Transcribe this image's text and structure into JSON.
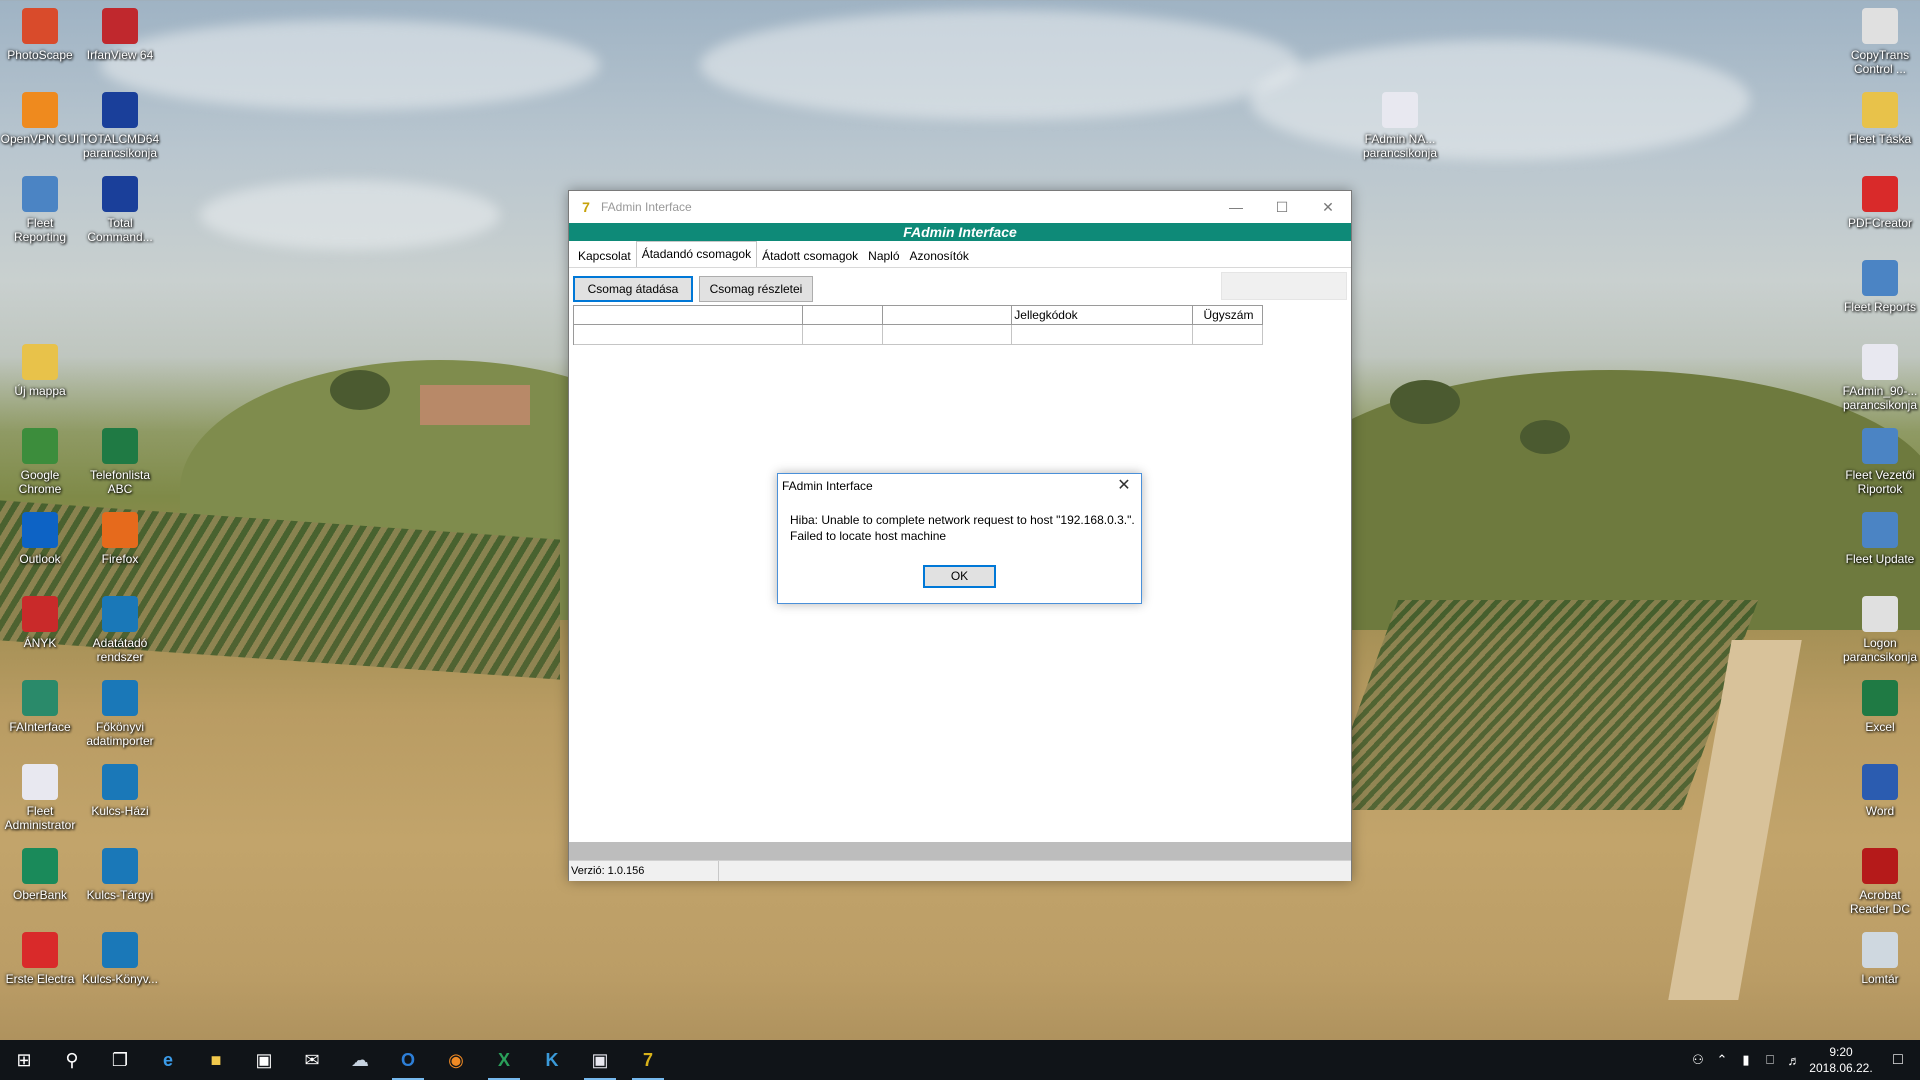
{
  "desktop": {
    "left_icons": [
      {
        "label": "PhotoScape",
        "icon": "photoscape-icon",
        "color": "#d94b2b"
      },
      {
        "label": "IrfanView 64",
        "icon": "irfanview-icon",
        "color": "#c0282d"
      },
      {
        "label": "OpenVPN GUI",
        "icon": "openvpn-icon",
        "color": "#ef8a1e"
      },
      {
        "label": "TOTALCMD64 parancsikonja",
        "icon": "totalcmd-icon",
        "color": "#1a3f9a"
      },
      {
        "label": "Fleet Reporting",
        "icon": "fleet-reporting-icon",
        "color": "#4b84c4"
      },
      {
        "label": "Total Command...",
        "icon": "total-commander-icon",
        "color": "#1a3f9a"
      },
      {
        "label": "Új mappa",
        "icon": "folder-icon",
        "color": "#e8c24a"
      },
      {
        "label": "Google Chrome",
        "icon": "chrome-icon",
        "color": "#3c8d3c"
      },
      {
        "label": "Telefonlista ABC",
        "icon": "excel-file-icon",
        "color": "#1f7a44"
      },
      {
        "label": "Outlook",
        "icon": "outlook-icon",
        "color": "#0d63c5"
      },
      {
        "label": "Firefox",
        "icon": "firefox-icon",
        "color": "#e66a1c"
      },
      {
        "label": "ÁNYK",
        "icon": "anyk-icon",
        "color": "#c92a2a"
      },
      {
        "label": "Adatátadó rendszer",
        "icon": "adatatado-icon",
        "color": "#1a78b8"
      },
      {
        "label": "FAInterface",
        "icon": "fainterface-icon",
        "color": "#2a8a6a"
      },
      {
        "label": "Főkönyvi adatimporter",
        "icon": "fokonyvi-icon",
        "color": "#1a78b8"
      },
      {
        "label": "Fleet Administrator",
        "icon": "fleet-admin-icon",
        "color": "#e8e8f0"
      },
      {
        "label": "Kulcs-Házi",
        "icon": "kulcs-hazi-icon",
        "color": "#1a78b8"
      },
      {
        "label": "OberBank",
        "icon": "oberbank-icon",
        "color": "#1a8a5a"
      },
      {
        "label": "Kulcs-Tárgyi",
        "icon": "kulcs-targyi-icon",
        "color": "#1a78b8"
      },
      {
        "label": "Erste Electra",
        "icon": "erste-electra-icon",
        "color": "#d92a2a"
      },
      {
        "label": "Kulcs-Könyv...",
        "icon": "kulcs-konyv-icon",
        "color": "#1a78b8"
      }
    ],
    "right_icons": [
      {
        "label": "CopyTrans Control ...",
        "icon": "copytrans-icon",
        "color": "#e0e0e0"
      },
      {
        "label": "FAdmin NA... parancsikonja",
        "icon": "fadmin-na-icon",
        "color": "#e8e8f0"
      },
      {
        "label": "Fleet Táska",
        "icon": "folder-icon",
        "color": "#e8c24a"
      },
      {
        "label": "PDFCreator",
        "icon": "pdfcreator-icon",
        "color": "#d92a2a"
      },
      {
        "label": "Fleet Reports",
        "icon": "fleet-reports-icon",
        "color": "#4b84c4"
      },
      {
        "label": "FAdmin_90-... parancsikonja",
        "icon": "fadmin-90-icon",
        "color": "#e8e8f0"
      },
      {
        "label": "Fleet Vezetői Riportok",
        "icon": "fleet-vezetoi-icon",
        "color": "#4b84c4"
      },
      {
        "label": "Fleet Update",
        "icon": "fleet-update-icon",
        "color": "#4b84c4"
      },
      {
        "label": "Logon parancsikonja",
        "icon": "logon-icon",
        "color": "#e0e0e0"
      },
      {
        "label": "Excel",
        "icon": "excel-icon",
        "color": "#1f7a44"
      },
      {
        "label": "Word",
        "icon": "word-icon",
        "color": "#2b5cb0"
      },
      {
        "label": "Acrobat Reader DC",
        "icon": "acrobat-icon",
        "color": "#b51a1a"
      },
      {
        "label": "Lomtár",
        "icon": "recycle-bin-icon",
        "color": "#cfd8e0"
      }
    ]
  },
  "window": {
    "title": "FAdmin Interface",
    "banner": "FAdmin Interface",
    "tabs": [
      "Kapcsolat",
      "Átadandó csomagok",
      "Átadott csomagok",
      "Napló",
      "Azonosítók"
    ],
    "active_tab": "Átadandó csomagok",
    "buttons": {
      "transfer": "Csomag átadása",
      "details": "Csomag részletei"
    },
    "grid_headers": [
      "",
      "",
      "",
      "Jellegkódok",
      "Ügyszám"
    ],
    "status_version": "Verzió: 1.0.156",
    "banner_color": "#0e8a78"
  },
  "dialog": {
    "title": "FAdmin Interface",
    "message_line1": "Hiba: Unable to complete network request to host \"192.168.0.3.\".",
    "message_line2": "Failed to locate host machine",
    "ok_label": "OK"
  },
  "taskbar": {
    "items": [
      "start-icon",
      "search-icon",
      "task-view-icon",
      "edge-icon",
      "file-explorer-icon",
      "store-icon",
      "mail-icon",
      "app-icon",
      "outlook-icon",
      "firefox-icon",
      "excel-icon",
      "kulcs-icon",
      "fadmin-icon",
      "fainterface-icon"
    ],
    "time": "9:20",
    "date": "2018.06.22."
  }
}
